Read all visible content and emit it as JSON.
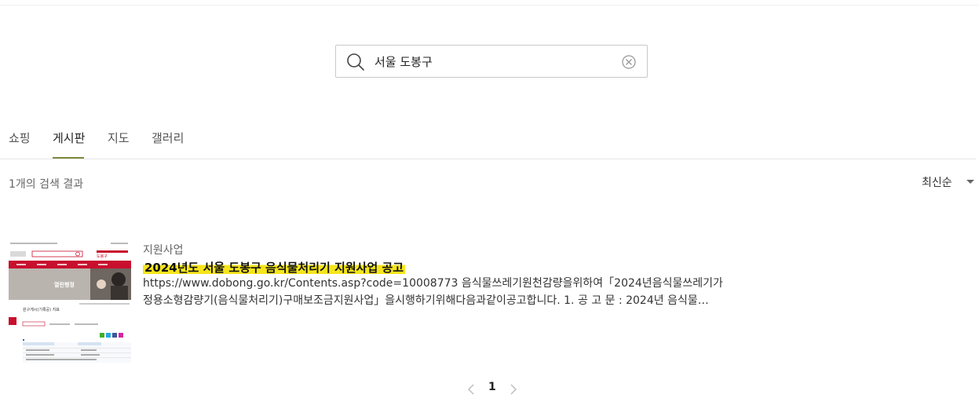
{
  "search": {
    "value": "서울 도봉구"
  },
  "tabs": [
    {
      "label": "쇼핑"
    },
    {
      "label": "게시판",
      "active": true
    },
    {
      "label": "지도"
    },
    {
      "label": "갤러리"
    }
  ],
  "results_meta": {
    "count_text": "1개의 검색 결과",
    "sort_label": "최신순"
  },
  "results": [
    {
      "category": "지원사업",
      "title": "2024년도 서울 도봉구 음식물처리기 지원사업 공고",
      "desc_line1": "https://www.dobong.go.kr/Contents.asp?code=10008773 음식물쓰레기원천감량을위하여「2024년음식물쓰레기가",
      "desc_line2": "정용소형감량기(음식물처리기)구매보조금지원사업」을시행하기위해다음과같이공고합니다. 1. 공 고 문 : 2024년 음식물…",
      "thumbnail": {
        "banner_label": "열린행정",
        "post_heading": "원구게시(기록공) 지표",
        "logo_text": "도봉구"
      }
    }
  ],
  "pagination": {
    "current": "1"
  },
  "colors": {
    "accent_underline": "#7c8a3f",
    "highlight": "#f5e51b",
    "thumb_nav": "#c8102e"
  }
}
